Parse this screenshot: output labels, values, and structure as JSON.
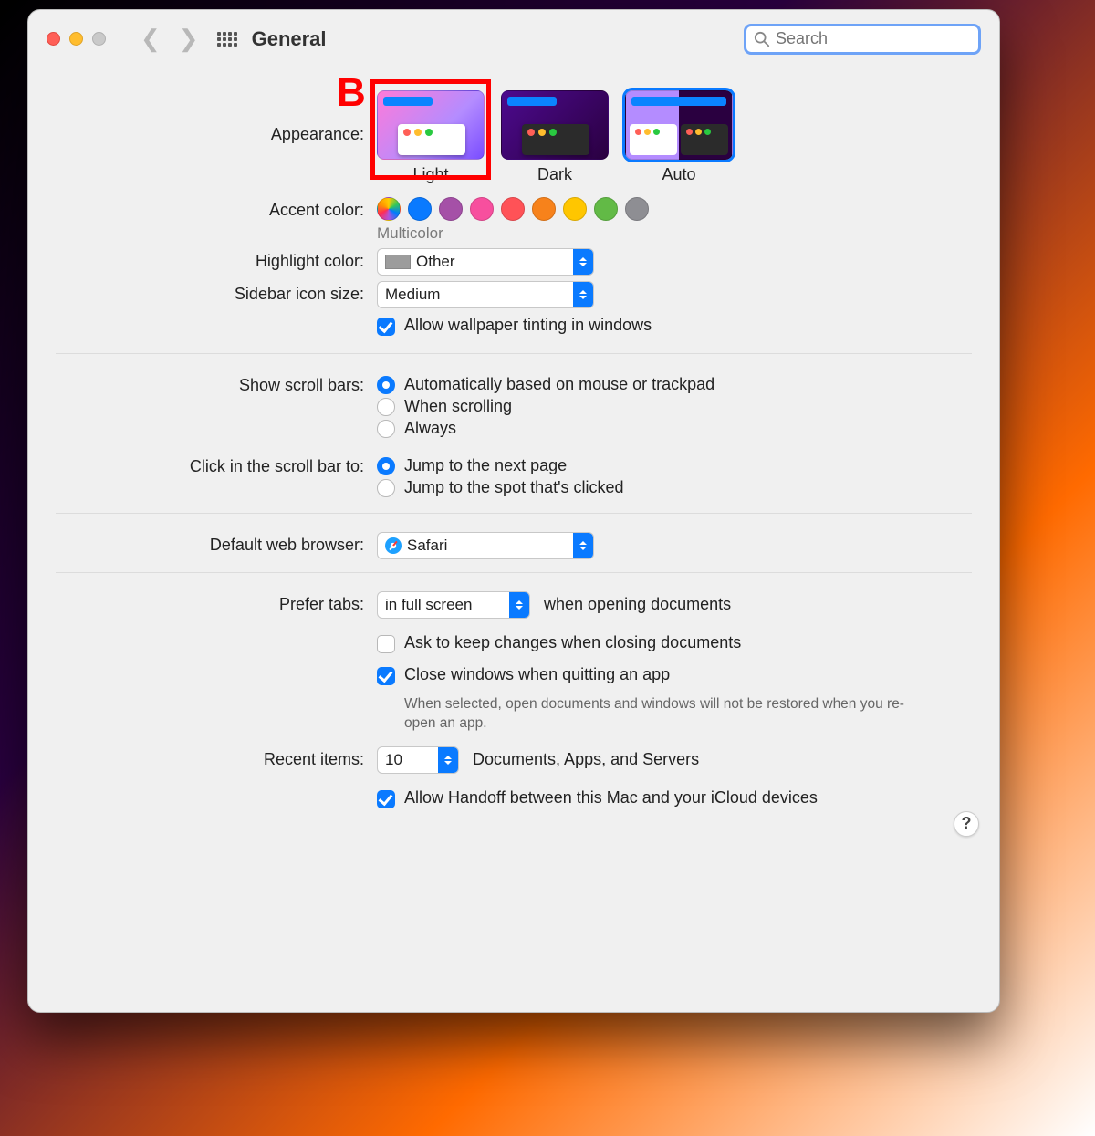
{
  "toolbar": {
    "title": "General",
    "search_placeholder": "Search"
  },
  "annotation": {
    "letter": "B"
  },
  "labels": {
    "appearance": "Appearance:",
    "accent": "Accent color:",
    "highlight": "Highlight color:",
    "sidebar_size": "Sidebar icon size:",
    "scrollbars": "Show scroll bars:",
    "click_scrollbar": "Click in the scroll bar to:",
    "default_browser": "Default web browser:",
    "prefer_tabs": "Prefer tabs:",
    "recent_items": "Recent items:"
  },
  "appearance": {
    "options": {
      "light": "Light",
      "dark": "Dark",
      "auto": "Auto"
    },
    "selected": "auto"
  },
  "accent": {
    "caption": "Multicolor",
    "colors": [
      "multi",
      "#0a7aff",
      "#a550a7",
      "#f74f9e",
      "#ff5257",
      "#f7821b",
      "#ffc600",
      "#62ba46",
      "#8e8e93"
    ]
  },
  "highlight": {
    "value": "Other"
  },
  "sidebar_size": {
    "value": "Medium"
  },
  "wallpaper_tint": {
    "label": "Allow wallpaper tinting in windows",
    "checked": true
  },
  "scrollbars": {
    "opt_auto": "Automatically based on mouse or trackpad",
    "opt_scrolling": "When scrolling",
    "opt_always": "Always",
    "selected": "auto"
  },
  "click_scrollbar": {
    "opt_next": "Jump to the next page",
    "opt_spot": "Jump to the spot that's clicked",
    "selected": "next"
  },
  "default_browser": {
    "value": "Safari"
  },
  "prefer_tabs": {
    "value": "in full screen",
    "suffix": "when opening documents"
  },
  "ask_keep_changes": {
    "label": "Ask to keep changes when closing documents",
    "checked": false
  },
  "close_windows": {
    "label": "Close windows when quitting an app",
    "checked": true,
    "help": "When selected, open documents and windows will not be restored when you re-open an app."
  },
  "recent_items": {
    "value": "10",
    "suffix": "Documents, Apps, and Servers"
  },
  "handoff": {
    "label": "Allow Handoff between this Mac and your iCloud devices",
    "checked": true
  },
  "help_button": "?"
}
